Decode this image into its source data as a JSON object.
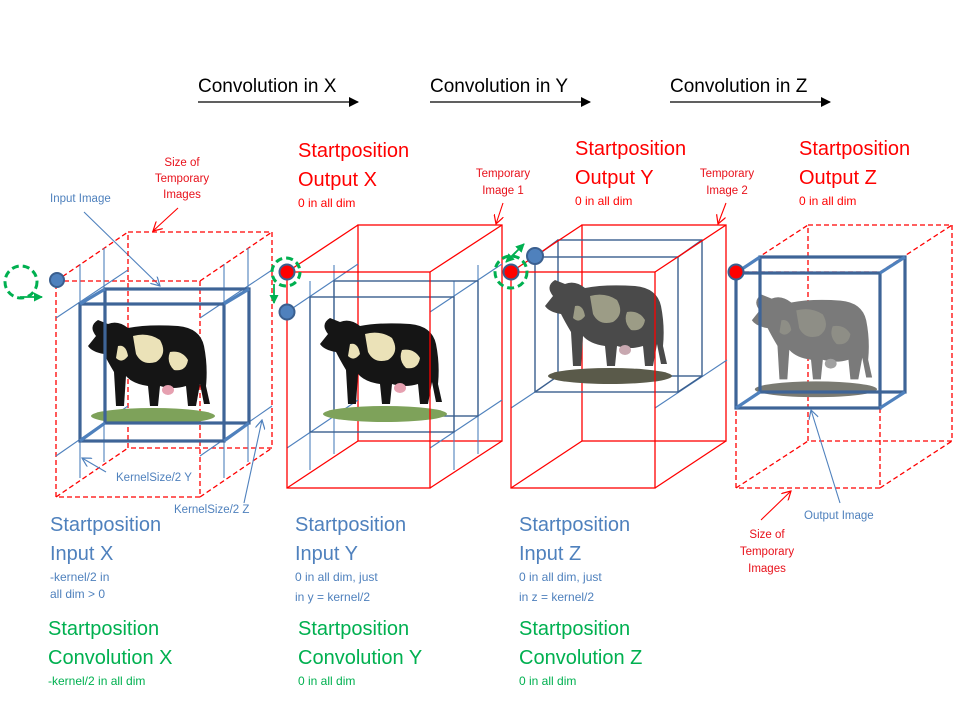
{
  "header": {
    "steps": [
      {
        "label": "Convolution in X"
      },
      {
        "label": "Convolution in Y"
      },
      {
        "label": "Convolution in Z"
      }
    ]
  },
  "output_positions": [
    {
      "line1": "Startposition",
      "line2": "Output X",
      "note": "0 in all dim"
    },
    {
      "line1": "Startposition",
      "line2": "Output Y",
      "note": "0 in all dim"
    },
    {
      "line1": "Startposition",
      "line2": "Output Z",
      "note": "0 in all dim"
    }
  ],
  "input_positions": [
    {
      "line1": "Startposition",
      "line2": "Input X",
      "note1": "-kernel/2 in",
      "note2": "all dim > 0"
    },
    {
      "line1": "Startposition",
      "line2": "Input Y",
      "note1": "0 in all dim, just",
      "note2": "in y = kernel/2"
    },
    {
      "line1": "Startposition",
      "line2": "Input Z",
      "note1": "0 in all dim, just",
      "note2": "in z = kernel/2"
    }
  ],
  "convolution_positions": [
    {
      "line1": "Startposition",
      "line2": "Convolution X",
      "note": "-kernel/2 in all dim"
    },
    {
      "line1": "Startposition",
      "line2": "Convolution Y",
      "note": "0 in all dim"
    },
    {
      "line1": "Startposition",
      "line2": "Convolution Z",
      "note": "0 in all dim"
    }
  ],
  "annotations": {
    "input_image": "Input Image",
    "size_temp_top": [
      "Size of",
      "Temporary",
      "Images"
    ],
    "temp_image_1": [
      "Temporary",
      "Image 1"
    ],
    "temp_image_2": [
      "Temporary",
      "Image 2"
    ],
    "kernel_y": "KernelSize/2 Y",
    "kernel_z": "KernelSize/2 Z",
    "output_image": "Output Image",
    "size_temp_bottom": [
      "Size of",
      "Temporary",
      "Images"
    ]
  },
  "colors": {
    "output_start": "#ff0000",
    "input_start": "#4f81bd",
    "convolution_start": "#00b050",
    "cube_outline": "#3e6497"
  }
}
